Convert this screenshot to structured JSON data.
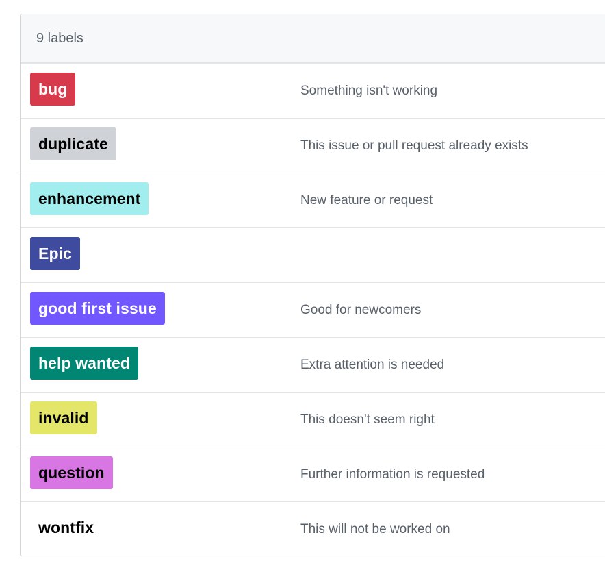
{
  "header": {
    "count_label": "9 labels"
  },
  "labels": [
    {
      "name": "bug",
      "description": "Something isn't working",
      "bg": "#d73a4a",
      "fg": "#ffffff"
    },
    {
      "name": "duplicate",
      "description": "This issue or pull request already exists",
      "bg": "#cfd3d7",
      "fg": "#000000"
    },
    {
      "name": "enhancement",
      "description": "New feature or request",
      "bg": "#a2eeef",
      "fg": "#000000"
    },
    {
      "name": "Epic",
      "description": "",
      "bg": "#3e4b9e",
      "fg": "#ffffff"
    },
    {
      "name": "good first issue",
      "description": "Good for newcomers",
      "bg": "#7057ff",
      "fg": "#ffffff"
    },
    {
      "name": "help wanted",
      "description": "Extra attention is needed",
      "bg": "#008672",
      "fg": "#ffffff"
    },
    {
      "name": "invalid",
      "description": "This doesn't seem right",
      "bg": "#e4e669",
      "fg": "#000000"
    },
    {
      "name": "question",
      "description": "Further information is requested",
      "bg": "#d876e3",
      "fg": "#000000"
    },
    {
      "name": "wontfix",
      "description": "This will not be worked on",
      "bg": "#ffffff",
      "fg": "#000000"
    }
  ]
}
